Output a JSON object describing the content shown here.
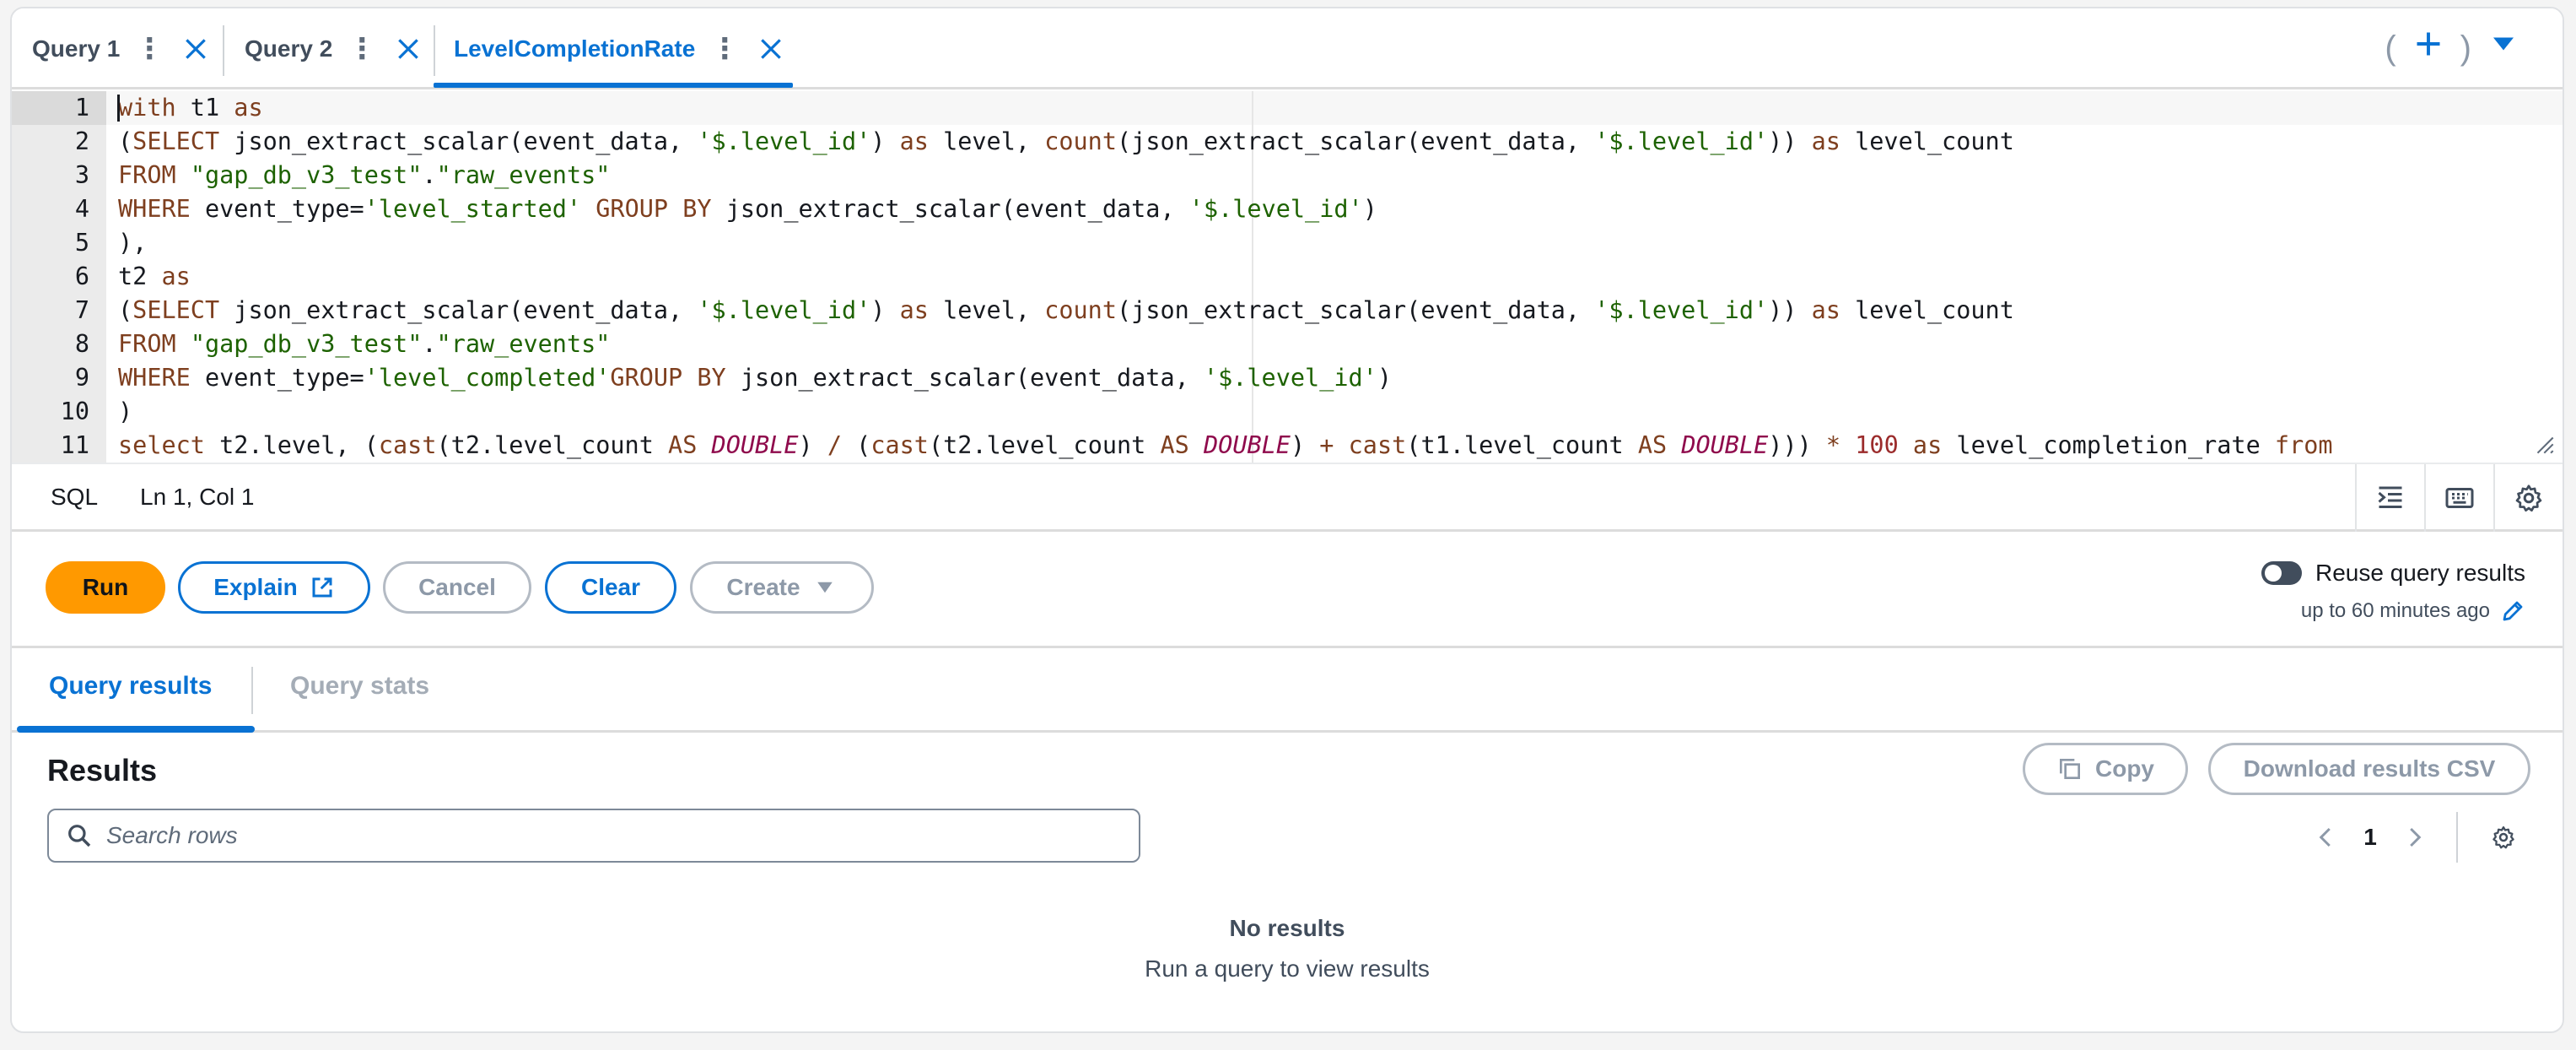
{
  "tabs": [
    {
      "label": "Query 1",
      "active": false
    },
    {
      "label": "Query 2",
      "active": false
    },
    {
      "label": "LevelCompletionRate",
      "active": true
    }
  ],
  "editor": {
    "line_numbers": [
      "1",
      "2",
      "3",
      "4",
      "5",
      "6",
      "7",
      "8",
      "9",
      "10",
      "11"
    ],
    "lines": [
      [
        [
          "k",
          "with"
        ],
        [
          "p",
          " t1 "
        ],
        [
          "k",
          "as"
        ]
      ],
      [
        [
          "p",
          "("
        ],
        [
          "k",
          "SELECT"
        ],
        [
          "p",
          " json_extract_scalar(event_data, "
        ],
        [
          "s",
          "'$.level_id'"
        ],
        [
          "p",
          ") "
        ],
        [
          "k",
          "as"
        ],
        [
          "p",
          " level, "
        ],
        [
          "k",
          "count"
        ],
        [
          "p",
          "(json_extract_scalar(event_data, "
        ],
        [
          "s",
          "'$.level_id'"
        ],
        [
          "p",
          ")) "
        ],
        [
          "k",
          "as"
        ],
        [
          "p",
          " level_count"
        ]
      ],
      [
        [
          "k",
          "FROM"
        ],
        [
          "p",
          " "
        ],
        [
          "s",
          "\"gap_db_v3_test\""
        ],
        [
          "p",
          "."
        ],
        [
          "s",
          "\"raw_events\""
        ]
      ],
      [
        [
          "k",
          "WHERE"
        ],
        [
          "p",
          " event_type="
        ],
        [
          "s",
          "'level_started'"
        ],
        [
          "p",
          " "
        ],
        [
          "k",
          "GROUP BY"
        ],
        [
          "p",
          " json_extract_scalar(event_data, "
        ],
        [
          "s",
          "'$.level_id'"
        ],
        [
          "p",
          ")"
        ]
      ],
      [
        [
          "p",
          "),"
        ]
      ],
      [
        [
          "p",
          "t2 "
        ],
        [
          "k",
          "as"
        ]
      ],
      [
        [
          "p",
          "("
        ],
        [
          "k",
          "SELECT"
        ],
        [
          "p",
          " json_extract_scalar(event_data, "
        ],
        [
          "s",
          "'$.level_id'"
        ],
        [
          "p",
          ") "
        ],
        [
          "k",
          "as"
        ],
        [
          "p",
          " level, "
        ],
        [
          "k",
          "count"
        ],
        [
          "p",
          "(json_extract_scalar(event_data, "
        ],
        [
          "s",
          "'$.level_id'"
        ],
        [
          "p",
          ")) "
        ],
        [
          "k",
          "as"
        ],
        [
          "p",
          " level_count"
        ]
      ],
      [
        [
          "k",
          "FROM"
        ],
        [
          "p",
          " "
        ],
        [
          "s",
          "\"gap_db_v3_test\""
        ],
        [
          "p",
          "."
        ],
        [
          "s",
          "\"raw_events\""
        ]
      ],
      [
        [
          "k",
          "WHERE"
        ],
        [
          "p",
          " event_type="
        ],
        [
          "s",
          "'level_completed'"
        ],
        [
          "k",
          "GROUP BY"
        ],
        [
          "p",
          " json_extract_scalar(event_data, "
        ],
        [
          "s",
          "'$.level_id'"
        ],
        [
          "p",
          ")"
        ]
      ],
      [
        [
          "p",
          ")"
        ]
      ],
      [
        [
          "k",
          "select"
        ],
        [
          "p",
          " t2.level, ("
        ],
        [
          "k",
          "cast"
        ],
        [
          "p",
          "(t2.level_count "
        ],
        [
          "k",
          "AS"
        ],
        [
          "p",
          " "
        ],
        [
          "t",
          "DOUBLE"
        ],
        [
          "p",
          ") "
        ],
        [
          "k",
          "/"
        ],
        [
          "p",
          " ("
        ],
        [
          "k",
          "cast"
        ],
        [
          "p",
          "(t2.level_count "
        ],
        [
          "k",
          "AS"
        ],
        [
          "p",
          " "
        ],
        [
          "t",
          "DOUBLE"
        ],
        [
          "p",
          ") "
        ],
        [
          "k",
          "+"
        ],
        [
          "p",
          " "
        ],
        [
          "k",
          "cast"
        ],
        [
          "p",
          "(t1.level_count "
        ],
        [
          "k",
          "AS"
        ],
        [
          "p",
          " "
        ],
        [
          "t",
          "DOUBLE"
        ],
        [
          "p",
          "))) "
        ],
        [
          "k",
          "*"
        ],
        [
          "p",
          " "
        ],
        [
          "n",
          "100"
        ],
        [
          "p",
          " "
        ],
        [
          "k",
          "as"
        ],
        [
          "p",
          " level_completion_rate "
        ],
        [
          "k",
          "from"
        ]
      ]
    ]
  },
  "statusbar": {
    "language": "SQL",
    "cursor_position": "Ln 1, Col 1"
  },
  "actions": {
    "run": "Run",
    "explain": "Explain",
    "cancel": "Cancel",
    "clear": "Clear",
    "create": "Create",
    "reuse_label": "Reuse query results",
    "reuse_sub": "up to 60 minutes ago"
  },
  "result_tabs": {
    "results": "Query results",
    "stats": "Query stats"
  },
  "results": {
    "title": "Results",
    "copy": "Copy",
    "download": "Download results CSV",
    "search_placeholder": "Search rows",
    "page": "1",
    "empty_title": "No results",
    "empty_sub": "Run a query to view results"
  },
  "colors": {
    "accent": "#0972d3",
    "primary_button": "#ff9900"
  }
}
